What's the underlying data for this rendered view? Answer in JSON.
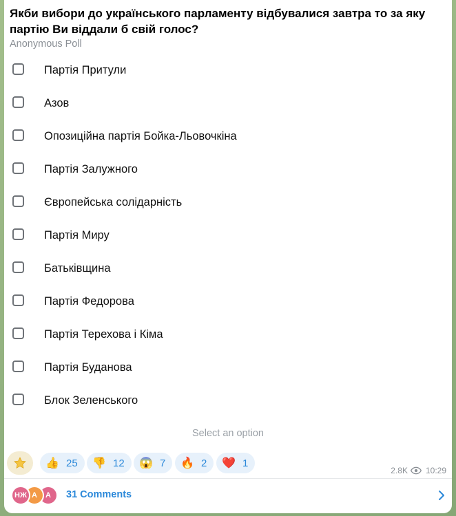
{
  "poll": {
    "question": "Якби вибори до українського парламенту відбувалися завтра то за яку партію Ви віддали б свій голос?",
    "type_label": "Anonymous Poll",
    "options": [
      "Партія Притули",
      "Азов",
      "Опозиційна партія Бойка-Льовочкіна",
      "Партія Залужного",
      "Європейська солідарність",
      "Партія Миру",
      "Батьківщина",
      "Партія Федорова",
      "Партія Терехова і Кіма",
      "Партія Буданова",
      "Блок Зеленського"
    ],
    "hint": "Select an option"
  },
  "reactions": [
    {
      "icon": "thumbs-up",
      "emoji": "👍",
      "count": "25"
    },
    {
      "icon": "thumbs-down",
      "emoji": "👎",
      "count": "12"
    },
    {
      "icon": "screaming-face",
      "emoji": "😱",
      "count": "7"
    },
    {
      "icon": "fire",
      "emoji": "🔥",
      "count": "2"
    },
    {
      "icon": "heart",
      "emoji": "❤️",
      "count": "1"
    }
  ],
  "meta": {
    "views": "2.8K",
    "time": "10:29"
  },
  "comments": {
    "label": "31 Comments",
    "avatars": [
      {
        "initials": "НЖ",
        "color": "#e0668b"
      },
      {
        "initials": "A",
        "color": "#f39a46"
      },
      {
        "initials": "A",
        "color": "#e0668b"
      }
    ]
  },
  "colors": {
    "accent": "#2b88d9",
    "chip_bg": "#e7f1fb",
    "star_bg": "#f4ecd2"
  }
}
